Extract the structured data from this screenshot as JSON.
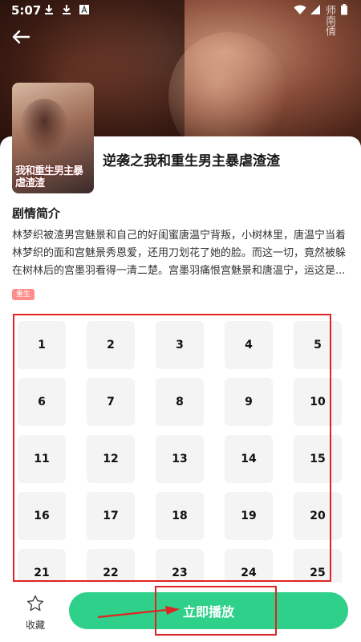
{
  "status_bar": {
    "time": "5:07"
  },
  "watermark": "师南倩",
  "poster": {
    "title_text": "我和重生男主暴虐渣渣"
  },
  "drama": {
    "title": "逆袭之我和重生男主暴虐渣渣",
    "synopsis_heading": "剧情简介",
    "synopsis": "林梦织被渣男宫魅景和自己的好闺蜜唐温宁背叛，小树林里，唐温宁当着林梦织的面和宫魅景秀恩爱，还用刀划花了她的脸。而这一切，竟然被躲在树林后的宫墨羽看得一清二楚。宫墨羽痛恨宫魅景和唐温宁，运这是...",
    "tag": "重生"
  },
  "episodes": [
    "1",
    "2",
    "3",
    "4",
    "5",
    "6",
    "7",
    "8",
    "9",
    "10",
    "11",
    "12",
    "13",
    "14",
    "15",
    "16",
    "17",
    "18",
    "19",
    "20",
    "21",
    "22",
    "23",
    "24",
    "25"
  ],
  "bottom_bar": {
    "favorite_label": "收藏",
    "play_label": "立即播放"
  },
  "colors": {
    "accent": "#2ed08a",
    "annotation_red": "#e02424",
    "tag": "#ff8c8c"
  }
}
